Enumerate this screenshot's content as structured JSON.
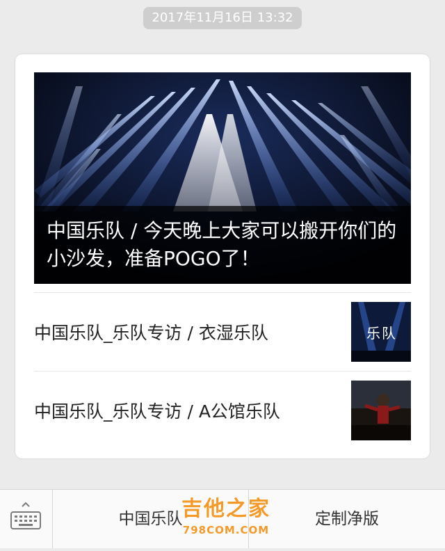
{
  "timestamp": "2017年11月16日 13:32",
  "main_article": {
    "title": "中国乐队 / 今天晚上大家可以搬开你们的小沙发，准备POGO了！"
  },
  "articles": [
    {
      "title": "中国乐队_乐队专访 / 衣湿乐队"
    },
    {
      "title": "中国乐队_乐队专访 / A公馆乐队"
    }
  ],
  "bottom_menu": {
    "keyboard_icon": "keyboard-icon",
    "items": [
      {
        "label": "中国乐队"
      },
      {
        "label": "定制净版"
      }
    ]
  },
  "watermark": {
    "main": "吉他之家",
    "sub": "798COM.COM"
  },
  "colors": {
    "background": "#ebebeb",
    "timestamp_bg": "#cecece",
    "watermark": "#f39a2a"
  }
}
